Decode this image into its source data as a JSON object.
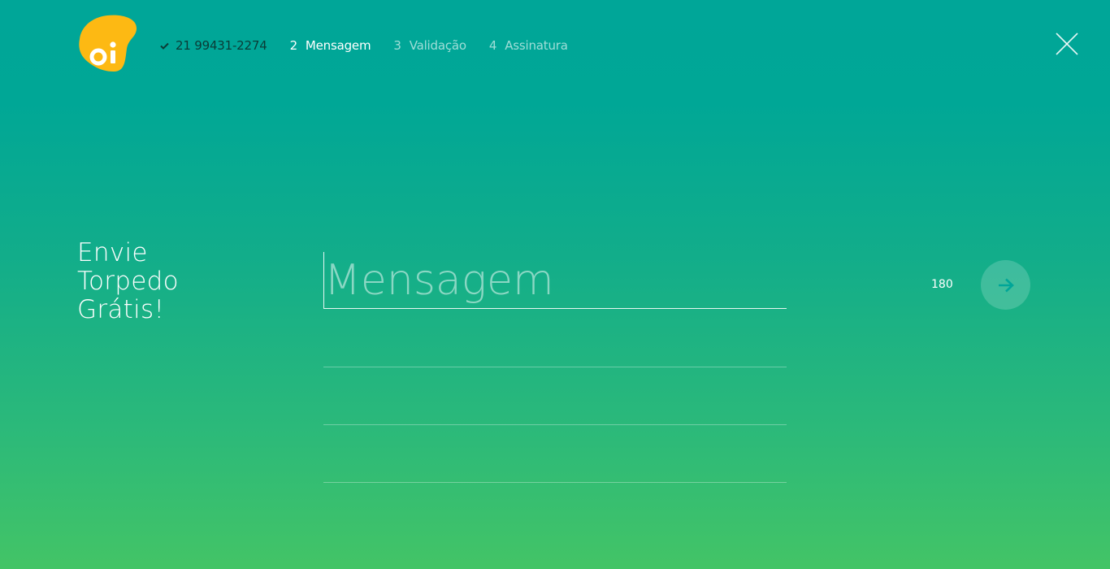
{
  "brand": {
    "logo_text": "oi",
    "logo_color": "#fdb913"
  },
  "steps": [
    {
      "number": "",
      "label": "21 99431-2274",
      "state": "done",
      "icon": "check-icon"
    },
    {
      "number": "2",
      "label": "Mensagem",
      "state": "active"
    },
    {
      "number": "3",
      "label": "Validação",
      "state": "pending"
    },
    {
      "number": "4",
      "label": "Assinatura",
      "state": "pending"
    }
  ],
  "headline": {
    "line1": "Envie",
    "line2": "Torpedo",
    "line3": "Grátis!"
  },
  "message": {
    "placeholder": "Mensagem",
    "value": "",
    "remaining": "180"
  },
  "icons": {
    "close": "close-icon",
    "send": "arrow-right-icon"
  },
  "colors": {
    "gradient_top": "#00a698",
    "gradient_bottom": "#43c466",
    "send_arrow": "#00a698",
    "done_step_text": "#0b3b36"
  }
}
